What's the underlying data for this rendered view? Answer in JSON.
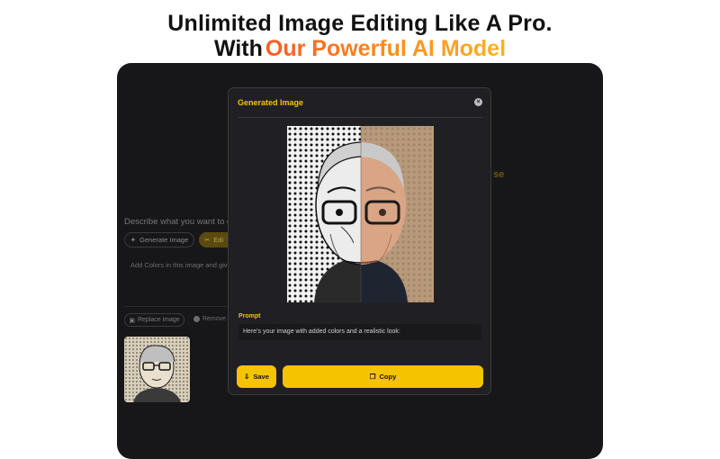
{
  "headline": {
    "line1": "Unlimited Image Editing Like A Pro.",
    "line2_prefix": "With",
    "line2_highlight": "Our Powerful AI Model"
  },
  "background_app": {
    "describe_label": "Describe what you want to ge",
    "generate_button": "Generate Image",
    "edit_button": "Edi",
    "prompt_text": "Add Colors in this image and give i",
    "partial_text": "se",
    "replace_button": "Replace image",
    "remove_button": "Remove"
  },
  "modal": {
    "title": "Generated Image",
    "prompt_label": "Prompt",
    "prompt_value": "Here's your image with added colors and a realistic look:",
    "save_label": "Save",
    "copy_label": "Copy"
  },
  "colors": {
    "accent": "#f5c400",
    "app_bg": "#17171a",
    "modal_bg": "#202024"
  }
}
